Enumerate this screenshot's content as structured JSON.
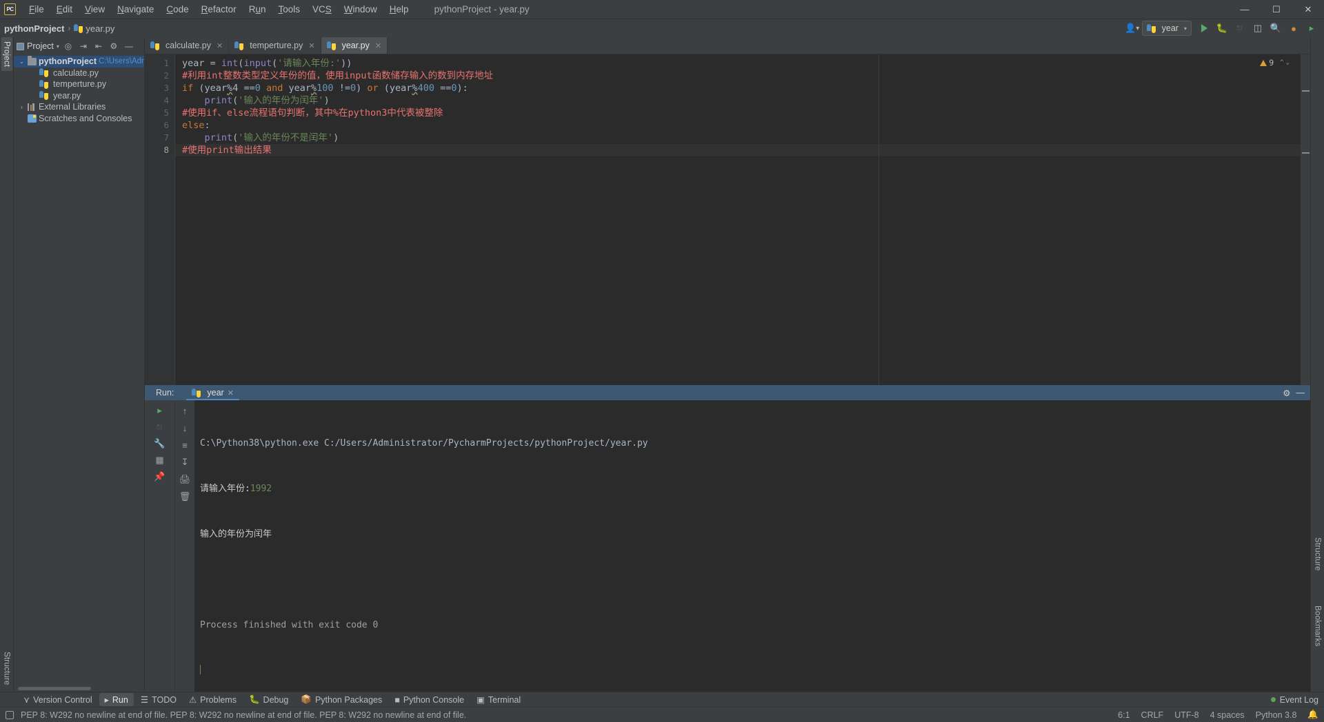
{
  "window": {
    "title": "pythonProject - year.py",
    "logo": "pc-logo",
    "controls": {
      "minimize": "─",
      "maximize": "☐",
      "close": "✕"
    }
  },
  "menu": {
    "items": [
      "File",
      "Edit",
      "View",
      "Navigate",
      "Code",
      "Refactor",
      "Run",
      "Tools",
      "VCS",
      "Window",
      "Help"
    ]
  },
  "navbar": {
    "breadcrumb": {
      "project": "pythonProject",
      "separator": "›",
      "file": "year.py"
    },
    "run_config": {
      "label": "year",
      "caret": "▾"
    },
    "buttons": {
      "avatar": "account-icon",
      "run": "run-button",
      "debug": "debug-button",
      "stop": "stop-button",
      "coverage": "coverage-button",
      "search": "search-button",
      "updates": "updates-button",
      "settings": "settings-button"
    }
  },
  "left_strip": {
    "tabs": [
      "Project"
    ]
  },
  "right_strip": {
    "tabs": [
      "Structure",
      "Bookmarks"
    ]
  },
  "project_pane": {
    "header": {
      "title": "Project",
      "caret": "▾"
    },
    "header_icons": [
      "locate-icon",
      "expand-all-icon",
      "collapse-all-icon",
      "gear-icon",
      "hide-icon"
    ],
    "tree": [
      {
        "arrow": "⌄",
        "icon": "folder-icon",
        "label": "pythonProject",
        "bold": true,
        "path": "C:\\Users\\Admini",
        "selected": true,
        "indent": 0
      },
      {
        "arrow": "",
        "icon": "python-file-icon",
        "label": "calculate.py",
        "bold": false,
        "path": "",
        "selected": false,
        "indent": 1
      },
      {
        "arrow": "",
        "icon": "python-file-icon",
        "label": "temperture.py",
        "bold": false,
        "path": "",
        "selected": false,
        "indent": 1
      },
      {
        "arrow": "",
        "icon": "python-file-icon",
        "label": "year.py",
        "bold": false,
        "path": "",
        "selected": false,
        "indent": 1
      },
      {
        "arrow": "›",
        "icon": "library-icon",
        "label": "External Libraries",
        "bold": false,
        "path": "",
        "selected": false,
        "indent": 0
      },
      {
        "arrow": "",
        "icon": "scratches-icon",
        "label": "Scratches and Consoles",
        "bold": false,
        "path": "",
        "selected": false,
        "indent": 0
      }
    ]
  },
  "editor": {
    "tabs": [
      {
        "label": "calculate.py",
        "active": false,
        "close": "✕"
      },
      {
        "label": "temperture.py",
        "active": false,
        "close": "✕"
      },
      {
        "label": "year.py",
        "active": true,
        "close": "✕"
      }
    ],
    "inspection_badge": {
      "count": "9",
      "icon": "warning-icon",
      "caret": "⌄"
    },
    "line_numbers": [
      "1",
      "2",
      "3",
      "4",
      "5",
      "6",
      "7",
      "8"
    ],
    "current_line": 8,
    "lines": [
      {
        "n": 1,
        "plain": "year = int(input('请输入年份:'))"
      },
      {
        "n": 2,
        "plain": "#利用int整数类型定义年份的值，使用input函数储存输入的数到内存地址"
      },
      {
        "n": 3,
        "plain": "if (year%4 ==0 and year%100 !=0) or (year%400 ==0):"
      },
      {
        "n": 4,
        "plain": "    print('输入的年份为闰年')"
      },
      {
        "n": 5,
        "plain": "#使用if、else流程语句判断，其中%在python3中代表被整除"
      },
      {
        "n": 6,
        "plain": "else:"
      },
      {
        "n": 7,
        "plain": "    print('输入的年份不是闰年')"
      },
      {
        "n": 8,
        "plain": "#使用print输出结果"
      }
    ]
  },
  "run_panel": {
    "label": "Run:",
    "tab": {
      "label": "year",
      "close": "✕"
    },
    "toolbar_icons": [
      "rerun-icon",
      "up-arrow-icon",
      "down-arrow-icon",
      "stop-icon",
      "soft-wrap-icon",
      "scroll-to-end-icon",
      "print-icon",
      "pin-icon",
      "trash-icon",
      "grid-icon",
      "wrench-icon"
    ],
    "header_icons": [
      "gear-icon",
      "hide-icon"
    ],
    "console": [
      {
        "text": "C:\\Python38\\python.exe C:/Users/Administrator/PycharmProjects/pythonProject/year.py",
        "cls": "c-cmd"
      },
      {
        "text": "请输入年份:",
        "value": "1992",
        "cls": "c-out"
      },
      {
        "text": "输入的年份为闰年",
        "cls": "c-out"
      },
      {
        "text": "",
        "cls": "c-out"
      },
      {
        "text": "Process finished with exit code 0",
        "cls": "c-fin"
      }
    ]
  },
  "bottom_bar": {
    "items": [
      {
        "label": "Version Control",
        "icon": "version-control-icon",
        "active": false
      },
      {
        "label": "Run",
        "icon": "run-icon",
        "active": true
      },
      {
        "label": "TODO",
        "icon": "todo-icon",
        "active": false
      },
      {
        "label": "Problems",
        "icon": "problems-icon",
        "active": false
      },
      {
        "label": "Debug",
        "icon": "debug-icon",
        "active": false
      },
      {
        "label": "Python Packages",
        "icon": "packages-icon",
        "active": false
      },
      {
        "label": "Python Console",
        "icon": "console-icon",
        "active": false
      },
      {
        "label": "Terminal",
        "icon": "terminal-icon",
        "active": false
      }
    ],
    "event_log": {
      "label": "Event Log",
      "icon": "event-log-icon"
    }
  },
  "status_bar": {
    "message": "PEP 8: W292 no newline at end of file. PEP 8: W292 no newline at end of file. PEP 8: W292 no newline at end of file.",
    "caret_position": "6:1",
    "line_separator": "CRLF",
    "encoding": "UTF-8",
    "indent": "4 spaces",
    "interpreter": "Python 3.8",
    "lock_icon": "lock-icon"
  },
  "colors": {
    "bg": "#3c3f41",
    "editor_bg": "#2b2b2b",
    "accent": "#4a88c7",
    "run_header": "#3f5872",
    "selection": "#2d4f77",
    "comment": "#e8736e",
    "string": "#6a8759",
    "keyword": "#cc7832",
    "number": "#6897bb"
  }
}
